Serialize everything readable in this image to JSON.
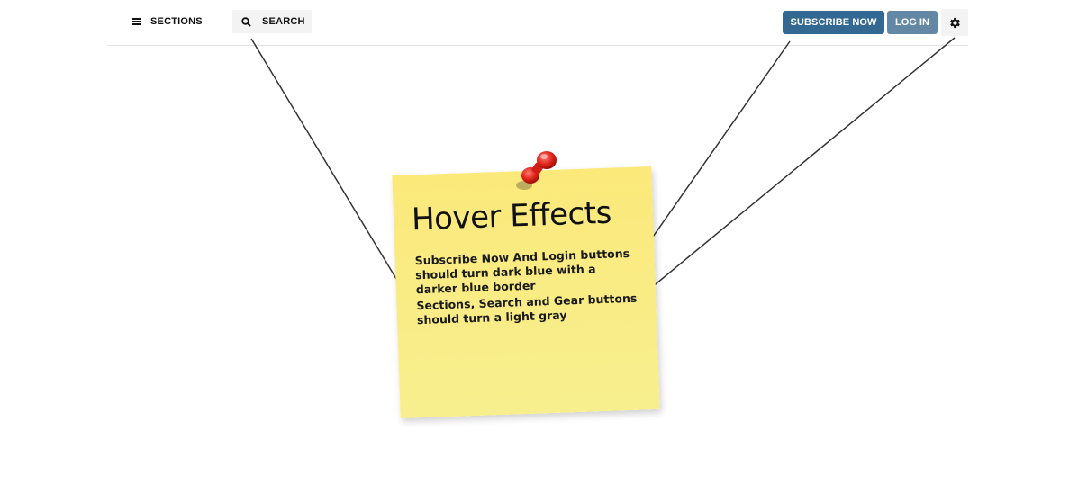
{
  "header": {
    "sections_label": "SECTIONS",
    "search_label": "SEARCH",
    "subscribe_label": "SUBSCRIBE NOW",
    "login_label": "LOG IN",
    "icons": {
      "sections": "hamburger-icon",
      "search": "search-icon",
      "settings": "gear-icon"
    }
  },
  "note": {
    "title": "Hover Effects",
    "line1": "Subscribe Now And Login buttons should turn dark blue with a darker blue border",
    "line2": "Sections, Search and Gear buttons should turn a light gray"
  },
  "colors": {
    "subscribe_bg": "#326891",
    "login_bg": "#6288a5",
    "note_bg": "#f9ec86",
    "pin": "#e0241b"
  }
}
